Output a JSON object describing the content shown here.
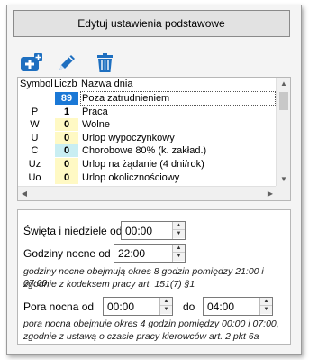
{
  "header": {
    "button_label": "Edytuj ustawienia podstawowe"
  },
  "toolbar": {
    "add_icon": "add-icon",
    "edit_icon": "pencil-icon",
    "delete_icon": "trash-icon",
    "accent": "#1e6fc0"
  },
  "grid": {
    "columns": [
      "Symbol",
      "Liczb",
      "Nazwa dnia"
    ],
    "rows": [
      {
        "symbol": "",
        "count": "89",
        "name": "Poza zatrudnieniem",
        "count_color": "#1a78d6",
        "count_text": "#ffffff"
      },
      {
        "symbol": "P",
        "count": "1",
        "name": "Praca",
        "count_color": "#ffffff",
        "count_text": "#000000"
      },
      {
        "symbol": "W",
        "count": "0",
        "name": "Wolne",
        "count_color": "#fff9c4",
        "count_text": "#000000"
      },
      {
        "symbol": "U",
        "count": "0",
        "name": "Urlop wypoczynkowy",
        "count_color": "#fff9c4",
        "count_text": "#000000"
      },
      {
        "symbol": "C",
        "count": "0",
        "name": "Chorobowe 80% (k. zakład.)",
        "count_color": "#c9eef2",
        "count_text": "#000000"
      },
      {
        "symbol": "Uz",
        "count": "0",
        "name": "Urlop na żądanie (4 dni/rok)",
        "count_color": "#fff9c4",
        "count_text": "#000000"
      },
      {
        "symbol": "Uo",
        "count": "0",
        "name": "Urlop okolicznościowy",
        "count_color": "#fff9c4",
        "count_text": "#000000"
      }
    ]
  },
  "settings": {
    "holidays_label": "Święta i niedziele od",
    "holidays_value": "00:00",
    "night_hours_label": "Godziny nocne od",
    "night_hours_value": "22:00",
    "night_hours_note_1": "godziny nocne obejmują okres 8 godzin pomiędzy 21:00 i 07:00,",
    "night_hours_note_2": "zgodnie z kodeksem pracy art. 151(7) §1",
    "night_time_label": "Pora nocna od",
    "night_time_from": "00:00",
    "night_time_to_label": "do",
    "night_time_to": "04:00",
    "night_time_note_1": "pora nocna obejmuje okres 4 godzin pomiędzy 00:00 i 07:00,",
    "night_time_note_2": "zgodnie z ustawą o czasie pracy kierowców art. 2 pkt 6a"
  }
}
